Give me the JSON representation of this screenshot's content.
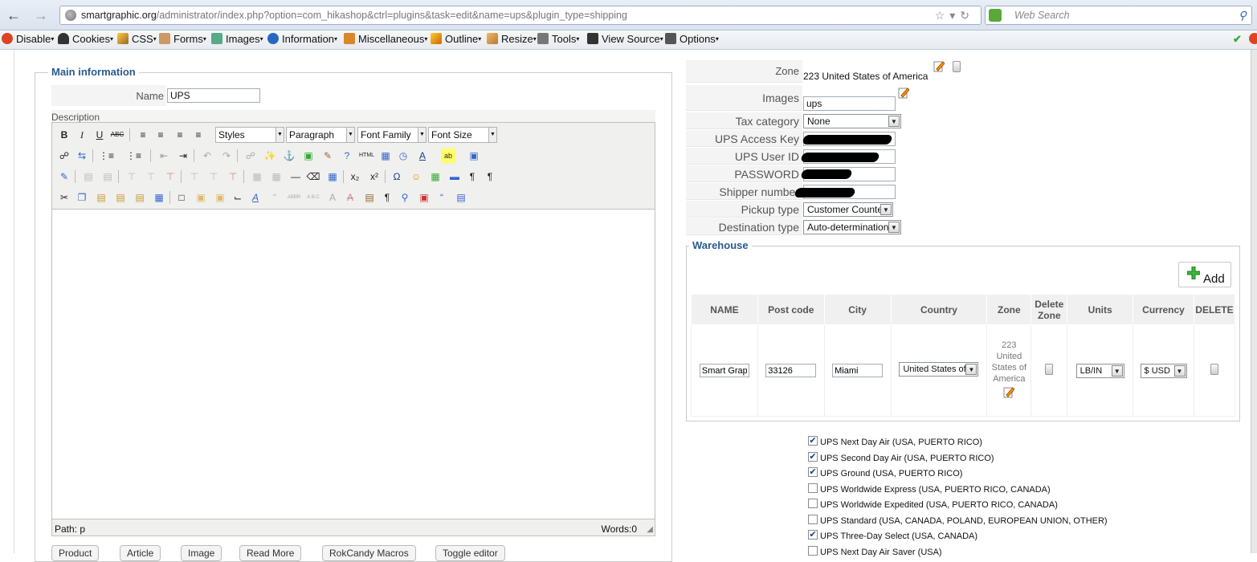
{
  "browser": {
    "url_host": "smartgraphic.org",
    "url_path": "/administrator/index.php?option=com_hikashop&ctrl=plugins&task=edit&name=ups&plugin_type=shipping",
    "search_placeholder": "Web Search"
  },
  "devtoolbar": {
    "items": [
      "Disable",
      "Cookies",
      "CSS",
      "Forms",
      "Images",
      "Information",
      "Miscellaneous",
      "Outline",
      "Resize",
      "Tools",
      "View Source",
      "Options"
    ]
  },
  "main": {
    "legend": "Main information",
    "name_label": "Name",
    "name_value": "UPS",
    "description_label": "Description",
    "editor": {
      "styles": "Styles",
      "format": "Paragraph",
      "font_family": "Font Family",
      "font_size": "Font Size",
      "path": "Path: p",
      "words": "Words:0"
    },
    "bottom_buttons": [
      "Product",
      "Article",
      "Image",
      "Read More",
      "RokCandy Macros",
      "Toggle editor"
    ]
  },
  "settings": {
    "zone_label": "Zone",
    "zone_value": "223 United States of America",
    "images_label": "Images",
    "images_value": "ups",
    "tax_label": "Tax category",
    "tax_value": "None",
    "access_key_label": "UPS Access Key",
    "user_id_label": "UPS User ID",
    "password_label": "PASSWORD",
    "shipper_label": "Shipper number",
    "pickup_label": "Pickup type",
    "pickup_value": "Customer Counter",
    "destination_label": "Destination type",
    "destination_value": "Auto-determination"
  },
  "warehouse": {
    "legend": "Warehouse",
    "add_label": "Add",
    "columns": [
      "NAME",
      "Post code",
      "City",
      "Country",
      "Zone",
      "Delete Zone",
      "Units",
      "Currency",
      "DELETE"
    ],
    "row": {
      "name": "Smart Graphic",
      "post_code": "33126",
      "city": "Miami",
      "country": "United States of",
      "zone": "223 United States of America",
      "units": "LB/IN",
      "currency": "$ USD"
    }
  },
  "services": [
    {
      "label": "UPS Next Day Air (USA, PUERTO RICO)",
      "checked": true
    },
    {
      "label": "UPS Second Day Air (USA, PUERTO RICO)",
      "checked": true
    },
    {
      "label": "UPS Ground (USA, PUERTO RICO)",
      "checked": true
    },
    {
      "label": "UPS Worldwide Express (USA, PUERTO RICO, CANADA)",
      "checked": false
    },
    {
      "label": "UPS Worldwide Expedited (USA, PUERTO RICO, CANADA)",
      "checked": false
    },
    {
      "label": "UPS Standard (USA, CANADA, POLAND, EUROPEAN UNION, OTHER)",
      "checked": false
    },
    {
      "label": "UPS Three-Day Select (USA, CANADA)",
      "checked": true
    },
    {
      "label": "UPS Next Day Air Saver (USA)",
      "checked": false
    }
  ]
}
